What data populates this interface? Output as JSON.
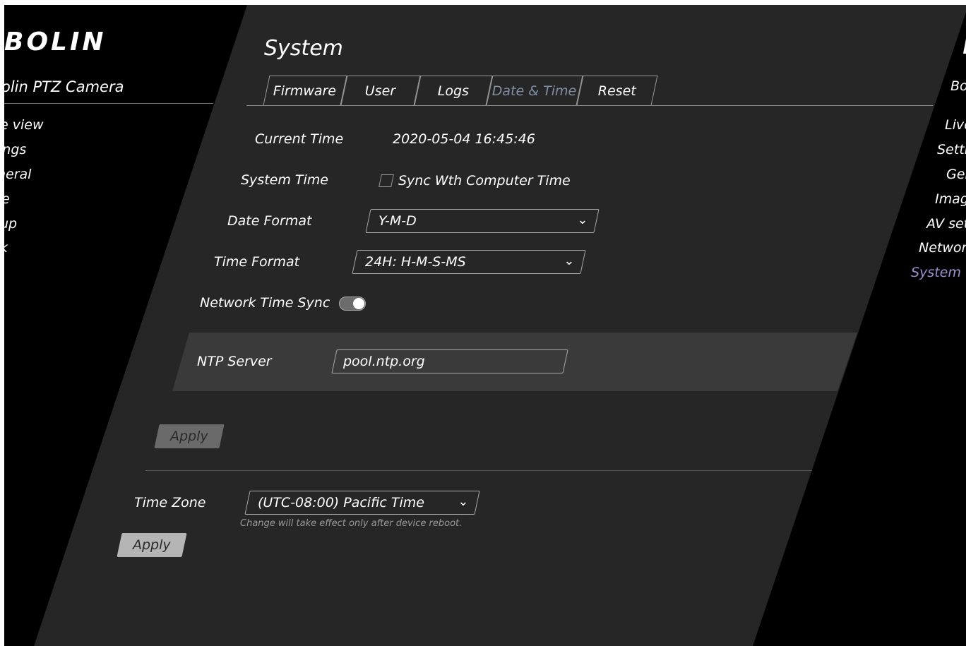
{
  "brand": {
    "logo": "BOLIN",
    "subtitle": "olin PTZ Camera",
    "logo_right": "Bo"
  },
  "nav_left": [
    "e view",
    "ings",
    "heral",
    "e",
    "up",
    "k"
  ],
  "nav_right": [
    {
      "label": "Live",
      "active": false
    },
    {
      "label": "Setti",
      "active": false
    },
    {
      "label": "Ger",
      "active": false
    },
    {
      "label": "Imag",
      "active": false
    },
    {
      "label": "AV set",
      "active": false
    },
    {
      "label": "Networ",
      "active": false
    },
    {
      "label": "System",
      "active": true
    }
  ],
  "page": {
    "title": "System"
  },
  "tabs": [
    {
      "label": "Firmware",
      "active": false
    },
    {
      "label": "User",
      "active": false
    },
    {
      "label": "Logs",
      "active": false
    },
    {
      "label": "Date & Time",
      "active": true
    },
    {
      "label": "Reset",
      "active": false
    }
  ],
  "fields": {
    "current_time": {
      "label": "Current Time",
      "value": "2020-05-04 16:45:46"
    },
    "system_time": {
      "label": "System Time",
      "checkbox_label": "Sync Wth Computer Time",
      "checked": false
    },
    "date_format": {
      "label": "Date Format",
      "selected": "Y-M-D"
    },
    "time_format": {
      "label": "Time Format",
      "selected": "24H: H-M-S-MS"
    },
    "network_time_sync": {
      "label": "Network Time Sync",
      "enabled": true
    },
    "ntp_server": {
      "label": "NTP Server",
      "value": "pool.ntp.org"
    },
    "apply_label": "Apply",
    "time_zone": {
      "label": "Time Zone",
      "selected": "(UTC-08:00) Pacific Time",
      "note": "Change will take effect only after device reboot."
    },
    "apply2_label": "Apply"
  },
  "colors": {
    "panel": "#262626",
    "background": "#000000",
    "active_tab": "#7f8fa6",
    "active_nav": "#9a8fd0"
  }
}
